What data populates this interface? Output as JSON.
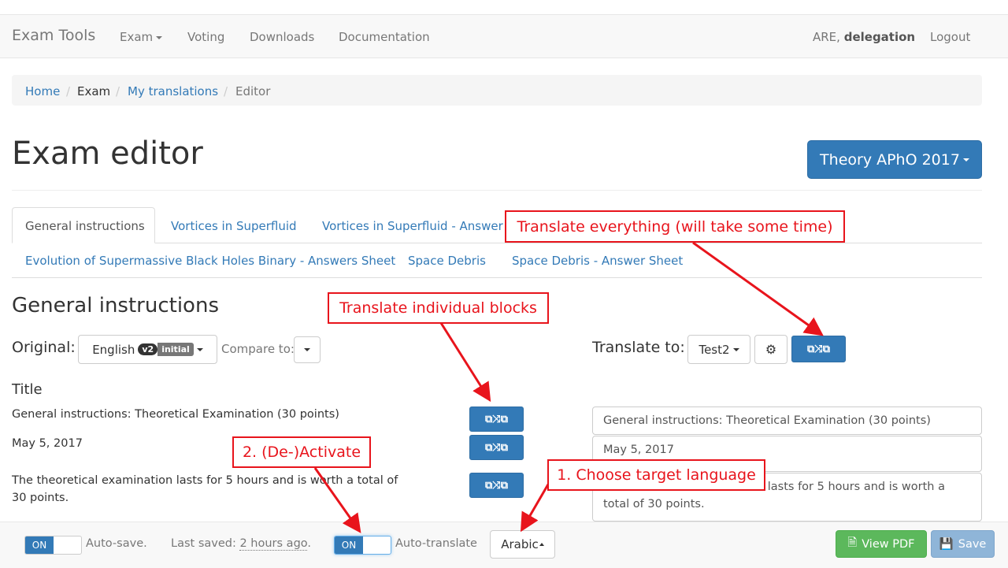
{
  "nav": {
    "brand": "Exam Tools",
    "exam": "Exam",
    "voting": "Voting",
    "downloads": "Downloads",
    "documentation": "Documentation",
    "user_prefix": "ARE,",
    "user_name": "delegation",
    "logout": "Logout"
  },
  "breadcrumb": {
    "home": "Home",
    "exam": "Exam",
    "my_translations": "My translations",
    "editor": "Editor",
    "sep": "/"
  },
  "page": {
    "title": "Exam editor",
    "exam_select": "Theory APhO 2017"
  },
  "tabs": [
    {
      "label": "General instructions"
    },
    {
      "label": "Vortices in Superfluid"
    },
    {
      "label": "Vortices in Superfluid - Answer Sheet"
    },
    {
      "label": "Evolution of Supermassive Black Holes Binary - Answers Sheet"
    },
    {
      "label": "Space Debris"
    },
    {
      "label": "Space Debris - Answer Sheet"
    }
  ],
  "section": {
    "heading": "General instructions",
    "original_label": "Original:",
    "original_lang": "English",
    "version_badge": "v2",
    "status_badge": "initial",
    "compare_label": "Compare to:",
    "translate_label": "Translate to:",
    "translate_target": "Test2",
    "block_title": "Title"
  },
  "original_blocks": [
    "General instructions: Theoretical Examination (30 points)",
    "May 5, 2017",
    "The theoretical examination lasts for 5 hours and is worth a total of",
    "30 points."
  ],
  "translated_blocks": [
    "General instructions: Theoretical Examination (30 points)",
    "May 5, 2017",
    "The theoretical examination lasts for 5 hours and is worth a",
    "total of 30 points."
  ],
  "footer": {
    "toggle_on": "ON",
    "auto_save": "Auto-save.",
    "last_saved_label": "Last saved:",
    "last_saved_value": "2 hours ago",
    "last_saved_dot": ".",
    "auto_translate": "Auto-translate",
    "language": "Arabic",
    "view_pdf": "View PDF",
    "save": "Save"
  },
  "annotations": {
    "translate_everything": "Translate everything (will take some time)",
    "translate_blocks": "Translate individual blocks",
    "deactivate": "2. (De-)Activate",
    "choose_language": "1. Choose target language"
  },
  "colors": {
    "primary": "#337ab7",
    "success": "#5cb85c",
    "annotation": "#e8141c"
  }
}
